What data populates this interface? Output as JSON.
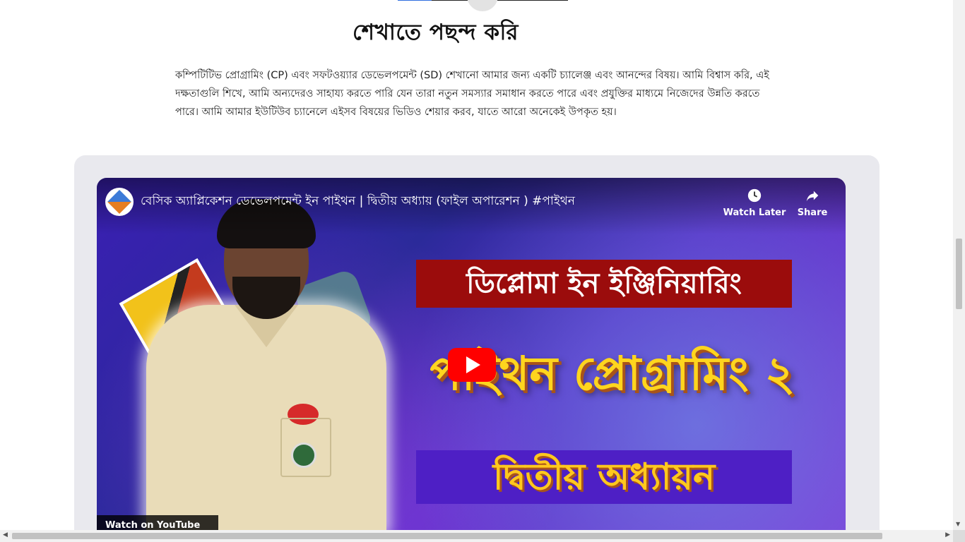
{
  "section": {
    "heading": "শেখাতে পছন্দ করি",
    "paragraph": "কম্পিটিটিভ প্রোগ্রামিং (CP) এবং সফটওয়্যার ডেভেলপমেন্ট (SD) শেখানো আমার জন্য একটি চ্যালেঞ্জ এবং আনন্দের বিষয়। আমি বিশ্বাস করি, এই দক্ষতাগুলি শিখে, আমি অন্যদেরও সাহায্য করতে পারি যেন তারা নতুন সমস্যার সমাধান করতে পারে এবং প্রযুক্তির মাধ্যমে নিজেদের উন্নতি করতে পারে। আমি আমার ইউটিউব চ্যানেলে এইসব বিষয়ের ভিডিও শেয়ার করব, যাতে আরো অনেকেই উপকৃত হয়।"
  },
  "video": {
    "title": "বেসিক অ্যাপ্লিকেশন ডেভেলপমেন্ট ইন পাইথন | দ্বিতীয় অধ্যায় (ফাইল অপারেশন ) #পাইথন",
    "watch_later_label": "Watch Later",
    "share_label": "Share",
    "thumbnail_text_1": "ডিপ্লোমা ইন ইঞ্জিনিয়ারিং",
    "thumbnail_text_2": "পাইথন প্রোগ্রামিং ২",
    "thumbnail_text_3": "দ্বিতীয় অধ্যায়ন",
    "watch_on_label": "Watch on YouTube",
    "play_icon": "play-icon",
    "accent_color": "#ff0000"
  }
}
